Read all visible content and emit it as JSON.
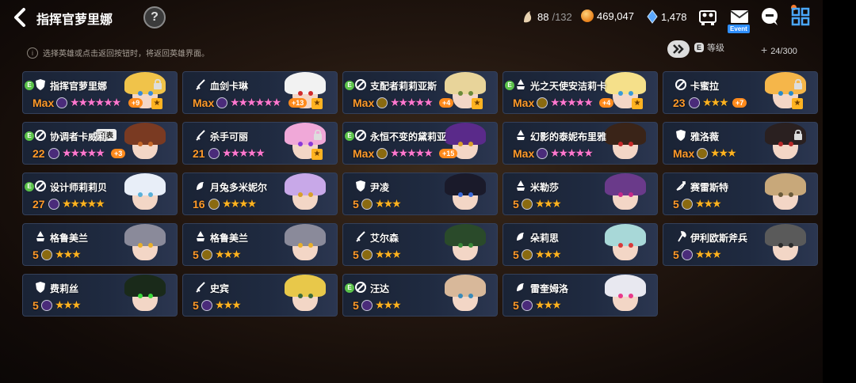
{
  "header": {
    "title": "指挥官萝里娜",
    "help_label": "?",
    "stamina_current": "88",
    "stamina_max": "/132",
    "gold": "469,047",
    "crystal": "1,478",
    "event_label": "Event"
  },
  "toolbar": {
    "hint": "选择英雄或点击返回按钮时，将返回英雄界面。",
    "hint_icon": "i",
    "grade_icon_label": "E",
    "grade_label": "等级",
    "count": "24/300",
    "count_plus": "+"
  },
  "colors": {
    "gold": "#ff9a2a",
    "star": "#ffb321",
    "card_bg": "#1f2a40",
    "badge_green": "#5bc24a",
    "plus_orange": "#ff8a1c",
    "event_blue": "#2f8fff"
  },
  "heroes": [
    {
      "name": "指挥官萝里娜",
      "level": "Max",
      "element": "dark",
      "stars": "★★★★★★",
      "pink": true,
      "plus": "+9",
      "e": "E",
      "lock": true,
      "fav": "★",
      "cls": "shield",
      "hair": "#f0c34a",
      "eye": "#3a8ad8"
    },
    {
      "name": "血剑卡琳",
      "level": "Max",
      "element": "dark",
      "stars": "★★★★★★",
      "pink": true,
      "plus": "+13",
      "e": "",
      "lock": false,
      "fav": "★",
      "cls": "sword",
      "hair": "#f2f2f2",
      "eye": "#d02b2b"
    },
    {
      "name": "支配者莉莉亚斯",
      "level": "Max",
      "element": "light",
      "stars": "★★★★★",
      "pink": true,
      "plus": "+4",
      "e": "E",
      "lock": false,
      "fav": "★",
      "cls": "no",
      "hair": "#e8d49a",
      "eye": "#6b8a3a"
    },
    {
      "name": "光之天使安洁莉卡",
      "level": "Max",
      "element": "light",
      "stars": "★★★★★",
      "pink": true,
      "plus": "+4",
      "e": "E",
      "lock": false,
      "fav": "★",
      "cls": "mage",
      "hair": "#f5e08a",
      "eye": "#3a9ad8"
    },
    {
      "name": "卡蜜拉",
      "level": "23",
      "element": "dark",
      "stars": "★★★",
      "pink": false,
      "plus": "+7",
      "e": "",
      "lock": true,
      "fav": "★",
      "cls": "no",
      "hair": "#f5b64a",
      "eye": "#2a8ac8"
    },
    {
      "name": "协调者卡威利",
      "level": "22",
      "element": "dark",
      "stars": "★★★★★",
      "pink": true,
      "plus": "+3",
      "e": "E",
      "lock": false,
      "fav": "",
      "cls": "no",
      "hair": "#7a3a22",
      "eye": "#c86a2a",
      "rep": "代表"
    },
    {
      "name": "杀手可丽",
      "level": "21",
      "element": "dark",
      "stars": "★★★★★",
      "pink": true,
      "plus": "",
      "e": "",
      "lock": true,
      "fav": "★",
      "cls": "sword",
      "hair": "#f0a8d8",
      "eye": "#8a3ad8"
    },
    {
      "name": "永恒不变的黛莉亚",
      "level": "Max",
      "element": "light",
      "stars": "★★★★★",
      "pink": true,
      "plus": "+15",
      "e": "E",
      "lock": false,
      "fav": "",
      "cls": "no",
      "hair": "#5a2a8a",
      "eye": "#d8a02a"
    },
    {
      "name": "幻影的泰妮布里雅",
      "level": "Max",
      "element": "dark",
      "stars": "★★★★★",
      "pink": true,
      "plus": "",
      "e": "",
      "lock": false,
      "fav": "",
      "cls": "mage",
      "hair": "#3a2418",
      "eye": "#c82a2a"
    },
    {
      "name": "雅洛薇",
      "level": "Max",
      "element": "light",
      "stars": "★★★",
      "pink": false,
      "plus": "",
      "e": "",
      "lock": true,
      "fav": "",
      "cls": "shield",
      "hair": "#2a2020",
      "eye": "#b82a2a"
    },
    {
      "name": "设计师莉莉贝",
      "level": "27",
      "element": "dark",
      "stars": "★★★★★",
      "pink": false,
      "plus": "",
      "e": "E",
      "lock": false,
      "fav": "",
      "cls": "no",
      "hair": "#e8eef8",
      "eye": "#5ab0d8"
    },
    {
      "name": "月兔多米妮尔",
      "level": "16",
      "element": "light",
      "stars": "★★★★",
      "pink": false,
      "plus": "",
      "e": "",
      "lock": false,
      "fav": "",
      "cls": "support",
      "hair": "#c8a8e8",
      "eye": "#d8a02a"
    },
    {
      "name": "尹凌",
      "level": "5",
      "element": "light",
      "stars": "★★★",
      "pink": false,
      "plus": "",
      "e": "",
      "lock": false,
      "fav": "",
      "cls": "shield",
      "hair": "#1a1a2a",
      "eye": "#3a6ad8"
    },
    {
      "name": "米勒莎",
      "level": "5",
      "element": "light",
      "stars": "★★★",
      "pink": false,
      "plus": "",
      "e": "",
      "lock": false,
      "fav": "",
      "cls": "mage",
      "hair": "#6a3a8a",
      "eye": "#c82a8a"
    },
    {
      "name": "赛雷斯特",
      "level": "5",
      "element": "light",
      "stars": "★★★",
      "pink": false,
      "plus": "",
      "e": "",
      "lock": false,
      "fav": "",
      "cls": "bow",
      "hair": "#c8a87a",
      "eye": "#6a5a3a"
    },
    {
      "name": "格鲁美兰",
      "level": "5",
      "element": "light",
      "stars": "★★★",
      "pink": false,
      "plus": "",
      "e": "",
      "lock": false,
      "fav": "",
      "cls": "mage",
      "hair": "#8a8a9a",
      "eye": "#e8b02a"
    },
    {
      "name": "格鲁美兰",
      "level": "5",
      "element": "light",
      "stars": "★★★",
      "pink": false,
      "plus": "",
      "e": "",
      "lock": false,
      "fav": "",
      "cls": "mage",
      "hair": "#8a8a9a",
      "eye": "#e8b02a"
    },
    {
      "name": "艾尔森",
      "level": "5",
      "element": "light",
      "stars": "★★★",
      "pink": false,
      "plus": "",
      "e": "",
      "lock": false,
      "fav": "",
      "cls": "sword",
      "hair": "#2a4a2a",
      "eye": "#3a8a3a"
    },
    {
      "name": "朵莉思",
      "level": "5",
      "element": "light",
      "stars": "★★★",
      "pink": false,
      "plus": "",
      "e": "",
      "lock": false,
      "fav": "",
      "cls": "support",
      "hair": "#a8d8d8",
      "eye": "#d83a3a"
    },
    {
      "name": "伊利欧斯斧兵",
      "level": "5",
      "element": "dark",
      "stars": "★★★",
      "pink": false,
      "plus": "",
      "e": "",
      "lock": false,
      "fav": "",
      "cls": "axe",
      "hair": "#5a5a5a",
      "eye": "#2a2a2a"
    },
    {
      "name": "费莉丝",
      "level": "5",
      "element": "dark",
      "stars": "★★★",
      "pink": false,
      "plus": "",
      "e": "",
      "lock": false,
      "fav": "",
      "cls": "shield",
      "hair": "#1a2a1a",
      "eye": "#3ad83a"
    },
    {
      "name": "史宾",
      "level": "5",
      "element": "dark",
      "stars": "★★★",
      "pink": false,
      "plus": "",
      "e": "",
      "lock": false,
      "fav": "",
      "cls": "sword",
      "hair": "#e8c84a",
      "eye": "#3a6a3a"
    },
    {
      "name": "汪达",
      "level": "5",
      "element": "dark",
      "stars": "★★★",
      "pink": false,
      "plus": "",
      "e": "E",
      "lock": false,
      "fav": "",
      "cls": "no",
      "hair": "#d8b89a",
      "eye": "#3a8ab8"
    },
    {
      "name": "雷奎姆洛",
      "level": "5",
      "element": "dark",
      "stars": "★★★",
      "pink": false,
      "plus": "",
      "e": "",
      "lock": false,
      "fav": "",
      "cls": "support",
      "hair": "#e8e8f0",
      "eye": "#e83a8a"
    }
  ]
}
